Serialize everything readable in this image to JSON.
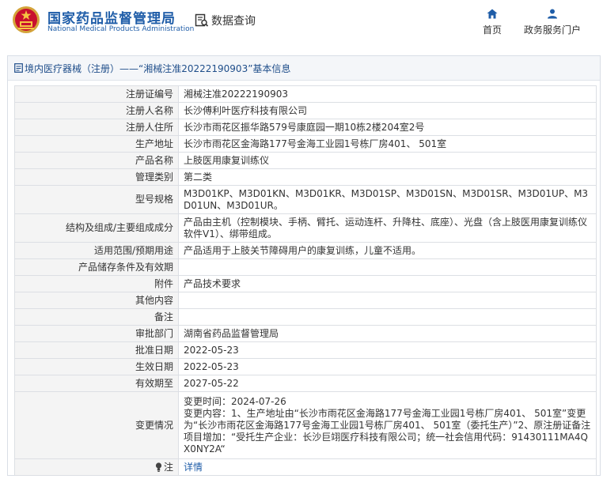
{
  "header": {
    "logo_cn": "国家药品监督管理局",
    "logo_en": "National Medical Products Administration",
    "query_label": "数据查询",
    "nav": [
      {
        "label": "首页",
        "icon": "home-icon"
      },
      {
        "label": "政务服务门户",
        "icon": "user-icon"
      }
    ]
  },
  "panel": {
    "title": "境内医疗器械（注册）——“湘械注准20222190903”基本信息"
  },
  "rows": [
    {
      "label": "注册证编号",
      "value": "湘械注准20222190903"
    },
    {
      "label": "注册人名称",
      "value": "长沙傅利叶医疗科技有限公司"
    },
    {
      "label": "注册人住所",
      "value": "长沙市雨花区振华路579号康庭园一期10栋2楼204室2号"
    },
    {
      "label": "生产地址",
      "value": "长沙市雨花区金海路177号金海工业园1号栋厂房401、 501室"
    },
    {
      "label": "产品名称",
      "value": "上肢医用康复训练仪"
    },
    {
      "label": "管理类别",
      "value": "第二类"
    },
    {
      "label": "型号规格",
      "value": "M3D01KP、M3D01KN、M3D01KR、M3D01SP、M3D01SN、M3D01SR、M3D01UP、M3D01UN、M3D01UR。"
    },
    {
      "label": "结构及组成/主要组成成分",
      "value": "产品由主机（控制模块、手柄、臂托、运动连杆、升降柱、底座）、光盘（含上肢医用康复训练仪软件V1）、绑带组成。"
    },
    {
      "label": "适用范围/预期用途",
      "value": "产品适用于上肢关节障碍用户的康复训练，儿童不适用。"
    },
    {
      "label": "产品储存条件及有效期",
      "value": ""
    },
    {
      "label": "附件",
      "value": "产品技术要求"
    },
    {
      "label": "其他内容",
      "value": ""
    },
    {
      "label": "备注",
      "value": ""
    },
    {
      "label": "审批部门",
      "value": "湖南省药品监督管理局"
    },
    {
      "label": "批准日期",
      "value": "2022-05-23"
    },
    {
      "label": "生效日期",
      "value": "2022-05-23"
    },
    {
      "label": "有效期至",
      "value": "2027-05-22"
    },
    {
      "label": "变更情况",
      "value": "变更时间：2024-07-26\n变更内容：1、生产地址由“长沙市雨花区金海路177号金海工业园1号栋厂房401、 501室”变更为“长沙市雨花区金海路177号金海工业园1号栋厂房401、 501室（委托生产）”2、原注册证备注项目增加：“受托生产企业：长沙巨翊医疗科技有限公司；统一社会信用代码：91430111MA4QX0NY2A“"
    }
  ],
  "note": {
    "label": "注",
    "link": "详情"
  },
  "colors": {
    "brand_blue": "#1f5da8",
    "label_bg": "#f4f4f4",
    "border": "#dcdfe4"
  }
}
